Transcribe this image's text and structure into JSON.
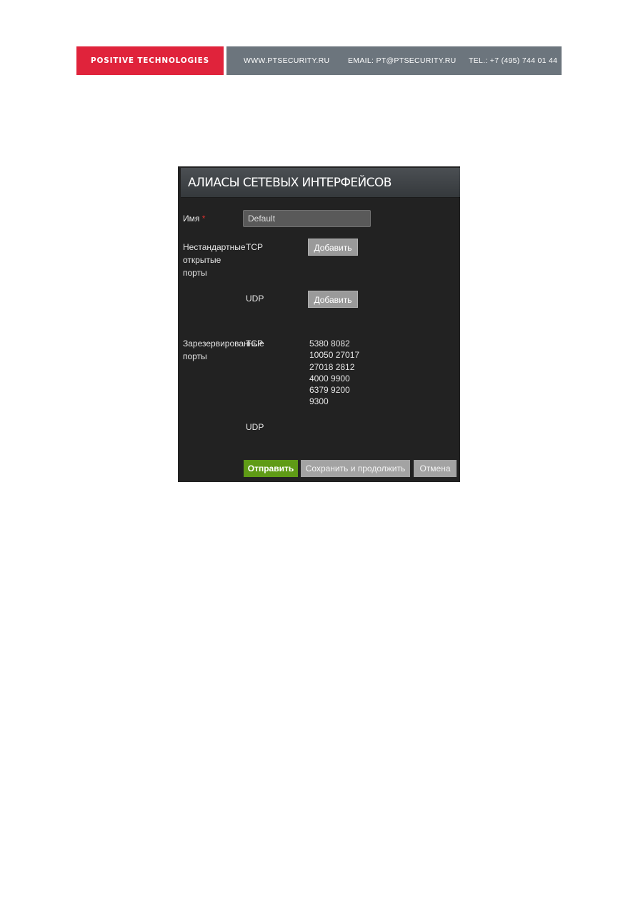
{
  "header": {
    "brand": "POSITIVE TECHNOLOGIES",
    "website": "WWW.PTSECURITY.RU",
    "email": "EMAIL: PT@PTSECURITY.RU",
    "phone": "TEL.: +7 (495) 744 01 44",
    "brand_color": "#e0233b",
    "bar_color": "#6c757d"
  },
  "form": {
    "title": "АЛИАСЫ СЕТЕВЫХ ИНТЕРФЕЙСОВ",
    "name_label": "Имя",
    "required_mark": "*",
    "name_value": "Default",
    "nonstandard_label": [
      "Нестандартные",
      "открытые",
      "порты"
    ],
    "tcp_label": "TCP",
    "udp_label": "UDP",
    "add_button": "Добавить",
    "reserved_label": [
      "Зарезервированные",
      "порты"
    ],
    "reserved_tcp_ports": [
      "5380 8082",
      "10050 27017",
      "27018 2812",
      "4000 9900",
      "6379 9200",
      "9300"
    ],
    "reserved_udp_ports": []
  },
  "actions": {
    "submit": "Отправить",
    "save_continue": "Сохранить и продолжить",
    "cancel": "Отмена",
    "submit_color": "#5f9b16"
  }
}
